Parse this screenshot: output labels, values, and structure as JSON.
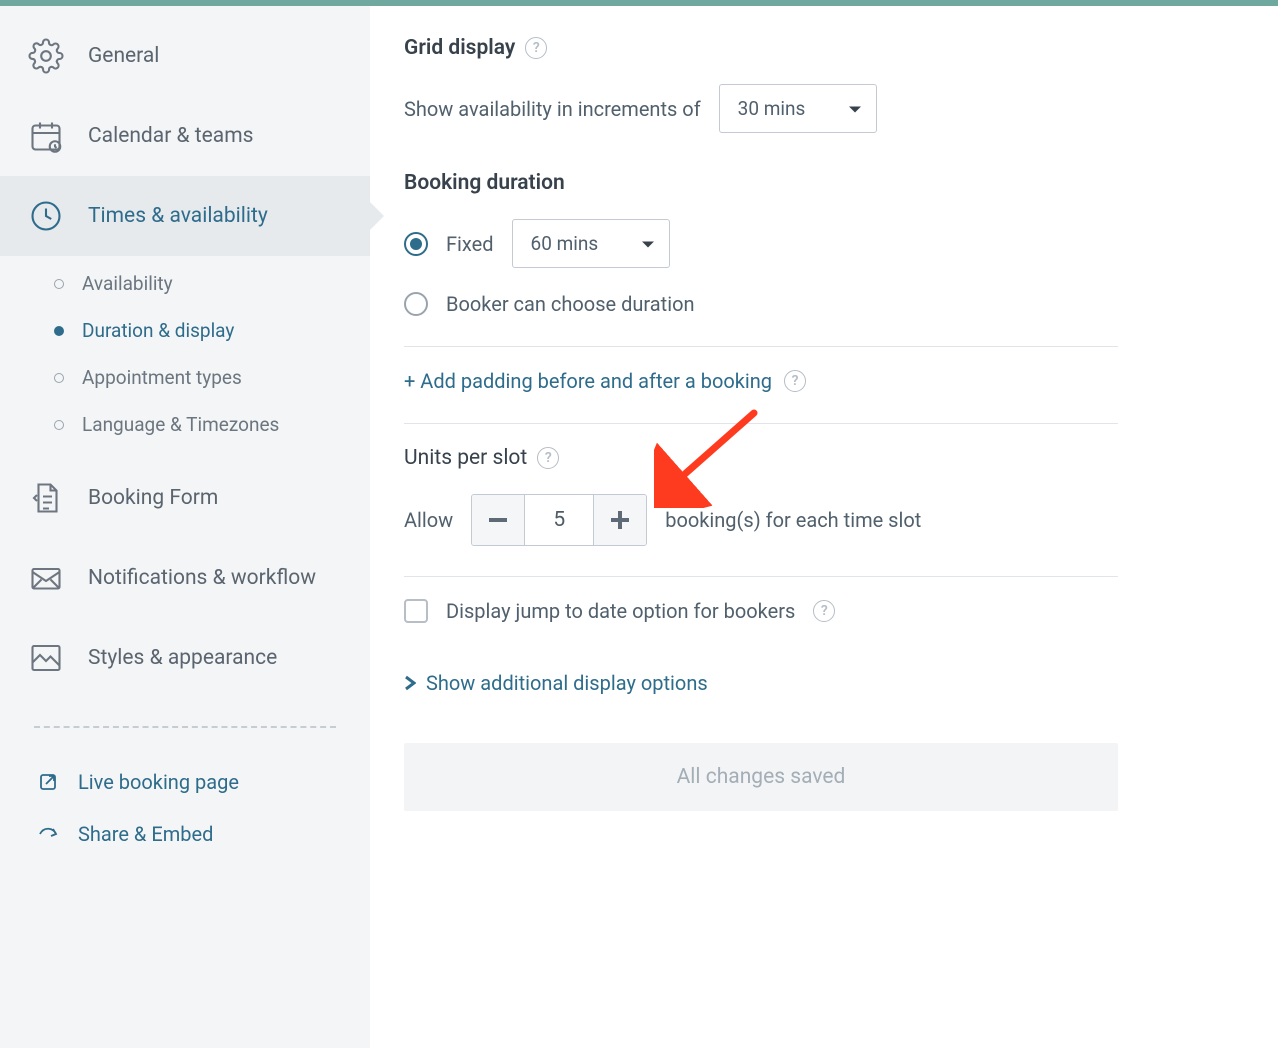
{
  "sidebar": {
    "items": [
      {
        "label": "General"
      },
      {
        "label": "Calendar & teams"
      },
      {
        "label": "Times & availability"
      },
      {
        "label": "Booking Form"
      },
      {
        "label": "Notifications & workflow"
      },
      {
        "label": "Styles & appearance"
      }
    ],
    "sub_items": [
      {
        "label": "Availability"
      },
      {
        "label": "Duration & display"
      },
      {
        "label": "Appointment types"
      },
      {
        "label": "Language & Timezones"
      }
    ],
    "links": [
      {
        "label": "Live booking page"
      },
      {
        "label": "Share & Embed"
      }
    ]
  },
  "main": {
    "grid_display": {
      "title": "Grid display",
      "increments_label": "Show availability in increments of",
      "increments_value": "30 mins"
    },
    "booking_duration": {
      "title": "Booking duration",
      "fixed_label": "Fixed",
      "fixed_value": "60 mins",
      "choose_label": "Booker can choose duration"
    },
    "add_padding_label": "+ Add padding before and after a booking",
    "units_per_slot": {
      "title": "Units per slot",
      "allow_label": "Allow",
      "value": "5",
      "suffix_label": "booking(s) for each time slot"
    },
    "jump_to_date_label": "Display jump to date option for bookers",
    "show_additional_label": "Show additional display options",
    "save_status": "All changes saved"
  }
}
